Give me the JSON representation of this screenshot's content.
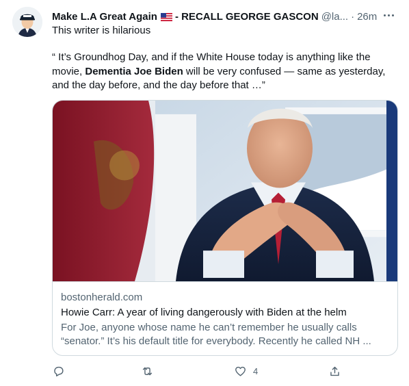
{
  "tweet": {
    "display_name": "Make L.A Great Again",
    "name_suffix": "- RECALL GEORGE GASCON",
    "handle": "@la...",
    "separator": "·",
    "time": "26m",
    "subtitle": "This writer is hilarious",
    "quote_part1": "“ It’s Groundhog Day, and if the White House today is anything like the movie, ",
    "quote_bold": "Dementia Joe Biden",
    "quote_part2": " will be very confused — same as yesterday, and the day before, and the day before that …”",
    "icons": {
      "flag": "us-flag-icon",
      "more": "more-icon",
      "reply": "reply-icon",
      "retweet": "retweet-icon",
      "like": "heart-icon",
      "share": "share-icon"
    }
  },
  "link_card": {
    "domain": "bostonherald.com",
    "title": "Howie Carr: A year of living dangerously with Biden at the helm",
    "description": "For Joe, anyone whose name he can’t remember he usually calls\n“senator.” It’s his default title for everybody. Recently he called NH ..."
  },
  "actions": {
    "like_count": "4"
  },
  "colors": {
    "text_primary": "#0f1419",
    "text_secondary": "#536471",
    "border": "#cfd9de"
  }
}
